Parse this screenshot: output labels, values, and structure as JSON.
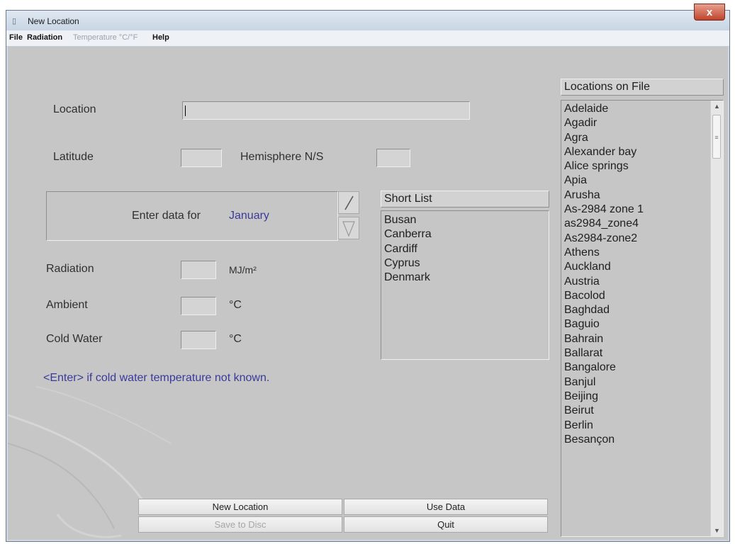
{
  "window": {
    "title": "New Location",
    "close_glyph": "x",
    "app_icon": "app-icon"
  },
  "menu": {
    "file": "File",
    "radiation": "Radiation",
    "temperature": "Temperature °C/°F",
    "help": "Help"
  },
  "form": {
    "location_label": "Location",
    "location_value": "",
    "latitude_label": "Latitude",
    "latitude_value": "",
    "hemisphere_label": "Hemisphere  N/S",
    "hemisphere_value": "",
    "enter_data_label": "Enter data for",
    "month": "January",
    "radiation_label": "Radiation",
    "radiation_unit": "MJ/m²",
    "radiation_value": "",
    "ambient_label": "Ambient",
    "ambient_unit": "°C",
    "ambient_value": "",
    "cold_water_label": "Cold Water",
    "cold_water_unit": "°C",
    "cold_water_value": "",
    "hint": "<Enter> if cold water temperature not known."
  },
  "short_list": {
    "header": "Short List",
    "items": [
      "Busan",
      "Canberra",
      "Cardiff",
      "Cyprus",
      "Denmark"
    ]
  },
  "locations": {
    "header": "Locations on File",
    "items": [
      "Adelaide",
      "Agadir",
      "Agra",
      "Alexander bay",
      "Alice springs",
      "Apia",
      "Arusha",
      "As-2984 zone 1",
      "as2984_zone4",
      "As2984-zone2",
      "Athens",
      "Auckland",
      "Austria",
      "Bacolod",
      "Baghdad",
      "Baguio",
      "Bahrain",
      "Ballarat",
      "Bangalore",
      "Banjul",
      "Beijing",
      "Beirut",
      "Berlin",
      "Besançon"
    ]
  },
  "buttons": {
    "new_location": "New Location",
    "use_data": "Use Data",
    "save_to_disc": "Save to Disc",
    "quit": "Quit"
  },
  "colors": {
    "accent_text": "#3a3a9a",
    "panel_bg": "#c6c6c6"
  }
}
